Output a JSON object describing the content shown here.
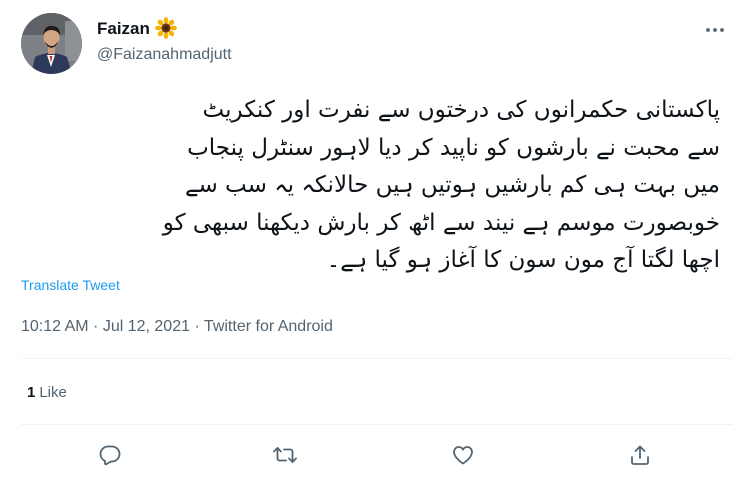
{
  "tweet": {
    "author": {
      "name": "Faizan",
      "name_emoji": "sunflower",
      "handle": "@Faizanahmadjutt",
      "avatar": "profile-photo"
    },
    "text": "پاکستانی حکمرانوں کی درختوں سے نفرت اور کنکریٹ\nسے محبت نے بارشوں کو ناپید کر دیا لاہور سنٹرل پنجاب\nمیں بہت ہی کم بارشیں ہوتیں ہیں حالانکہ یہ سب سے\nخوبصورت موسم ہے نیند سے اٹھ کر بارش دیکھنا سبھی کو\nاچھا لگتا آج مون سون کا آغاز ہو گیا ہے۔",
    "translate_label": "Translate Tweet",
    "meta": "10:12 AM · Jul 12, 2021 · Twitter for Android",
    "stats": {
      "likes_count": "1",
      "likes_label": "Like"
    }
  },
  "actions": {
    "reply_icon": "reply-icon",
    "retweet_icon": "retweet-icon",
    "like_icon": "heart-icon",
    "share_icon": "share-icon"
  },
  "colors": {
    "text_primary": "#0f1419",
    "text_secondary": "#536471",
    "link": "#1d9bf0",
    "divider": "#eff3f4"
  }
}
